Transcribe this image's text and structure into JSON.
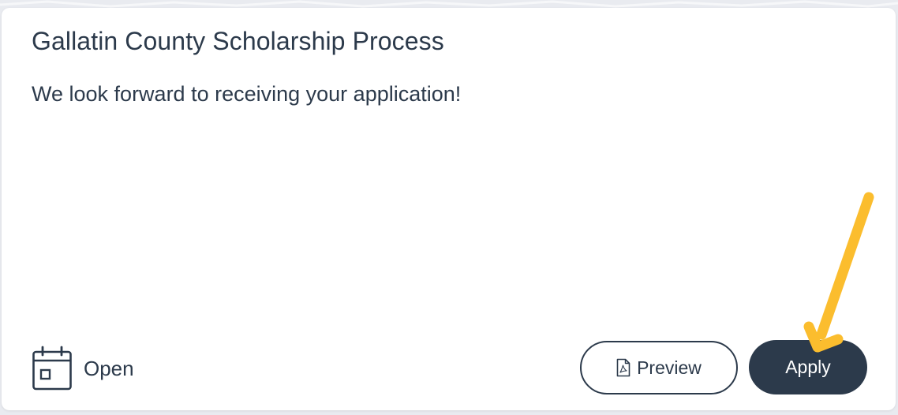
{
  "card": {
    "title": "Gallatin County Scholarship Process",
    "description": "We look forward to receiving your application!",
    "status": {
      "icon": "calendar-icon",
      "label": "Open"
    },
    "actions": {
      "preview_icon": "pdf-file-icon",
      "preview_label": "Preview",
      "apply_label": "Apply"
    }
  },
  "annotation": {
    "icon": "arrow-icon",
    "color": "#FBBD2E"
  },
  "colors": {
    "text": "#2C3A4B",
    "apply_bg": "#2C3A4B",
    "page_bg": "#E9EBF0",
    "card_bg": "#FFFFFF"
  }
}
